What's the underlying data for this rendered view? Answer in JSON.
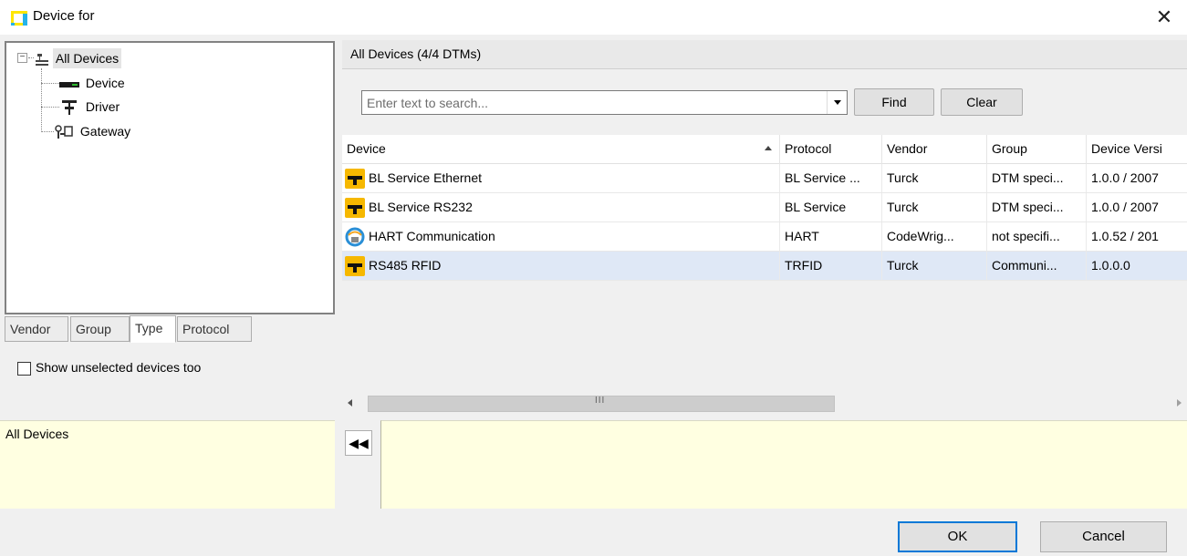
{
  "window": {
    "title": "Device for"
  },
  "tree": {
    "root": "All Devices",
    "children": [
      "Device",
      "Driver",
      "Gateway"
    ]
  },
  "tabs": [
    "Vendor",
    "Group",
    "Type",
    "Protocol"
  ],
  "active_tab": "Type",
  "show_unselected_label": "Show unselected devices too",
  "left_description": "All Devices",
  "right_header": "All Devices (4/4 DTMs)",
  "search": {
    "placeholder": "Enter text to search...",
    "find_label": "Find",
    "clear_label": "Clear"
  },
  "grid": {
    "columns": [
      "Device",
      "Protocol",
      "Vendor",
      "Group",
      "Device Versi"
    ],
    "rows": [
      {
        "device": "BL Service Ethernet",
        "protocol": "BL Service ...",
        "vendor": "Turck",
        "group": "DTM speci...",
        "version": "1.0.0 / 2007",
        "icon": "turck-icon"
      },
      {
        "device": "BL Service RS232",
        "protocol": "BL Service",
        "vendor": "Turck",
        "group": "DTM speci...",
        "version": "1.0.0 / 2007",
        "icon": "turck-icon"
      },
      {
        "device": "HART Communication",
        "protocol": "HART",
        "vendor": "CodeWrig...",
        "group": "not specifi...",
        "version": "1.0.52 / 201",
        "icon": "hart-icon"
      },
      {
        "device": "RS485 RFID",
        "protocol": "TRFID",
        "vendor": "Turck",
        "group": "Communi...",
        "version": "1.0.0.0",
        "icon": "turck-icon"
      }
    ],
    "selected_row": 3
  },
  "buttons": {
    "ok": "OK",
    "cancel": "Cancel"
  },
  "colors": {
    "description_bg": "#ffffe1",
    "selection_bg": "#dfe8f6",
    "turck_yellow": "#f6b800",
    "default_button_border": "#0078d7"
  }
}
